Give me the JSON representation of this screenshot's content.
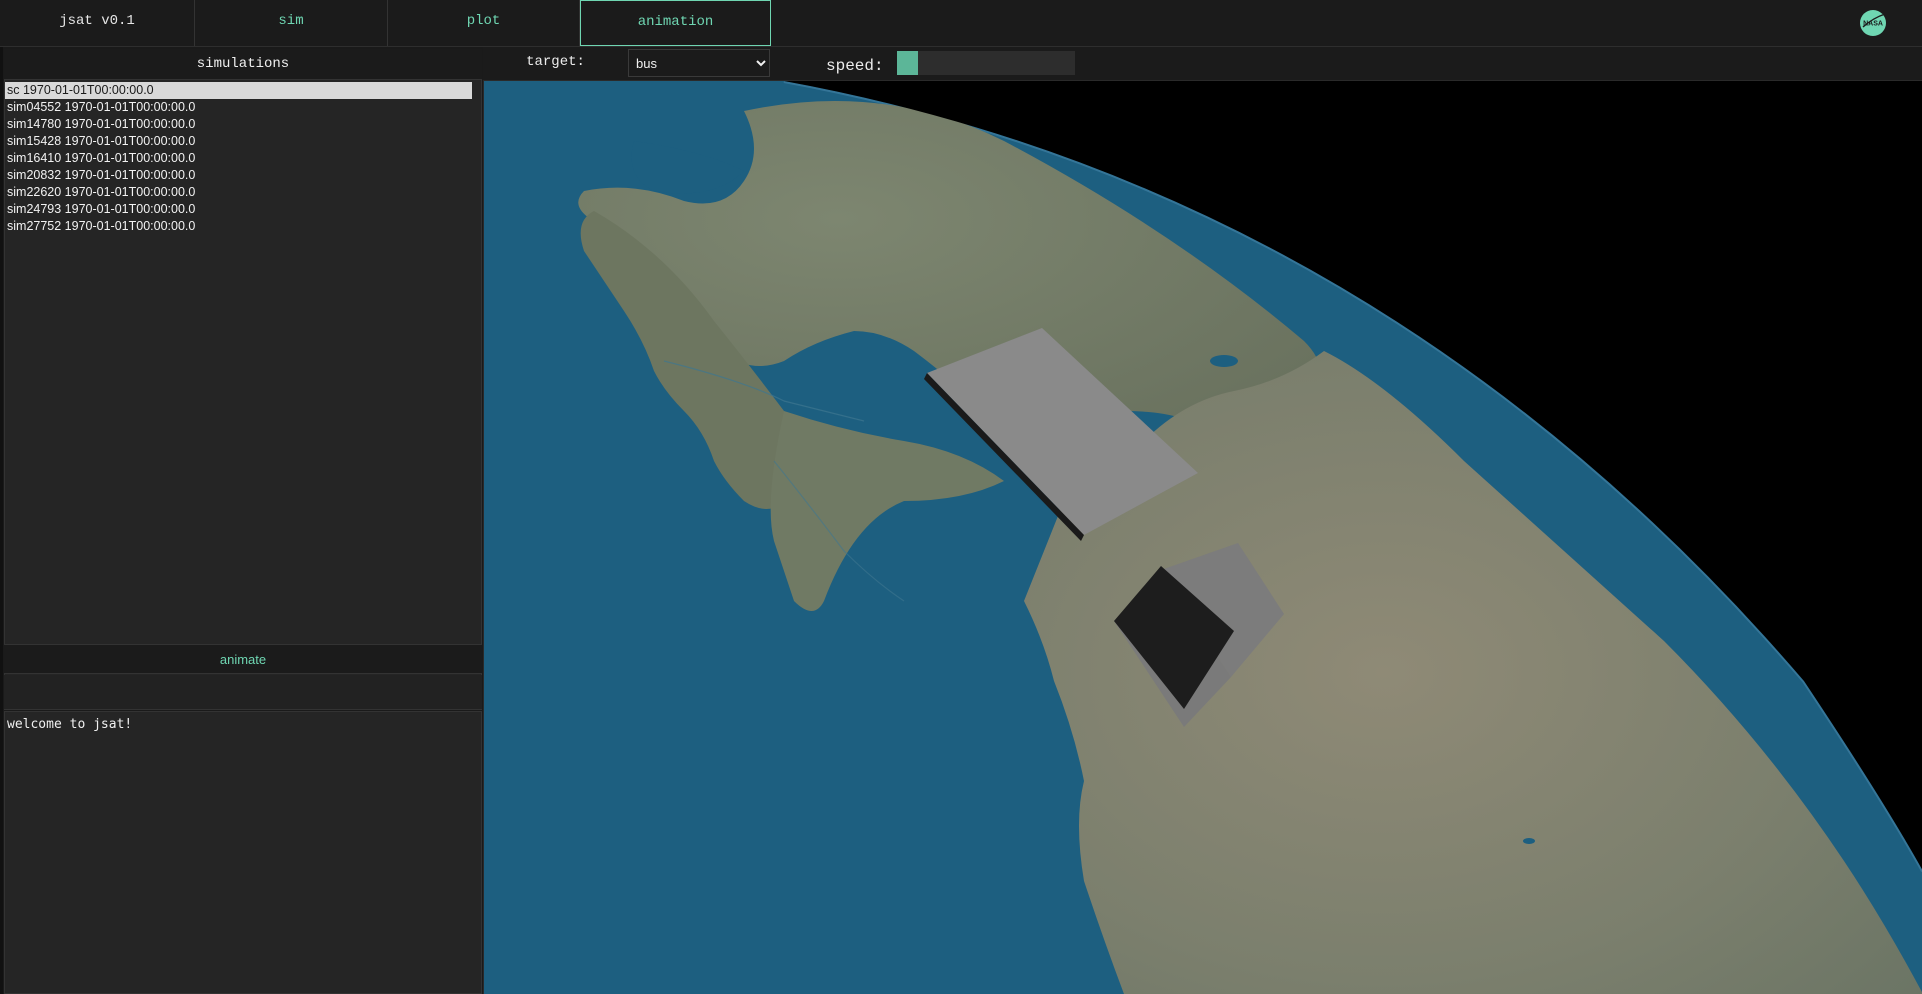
{
  "nav": {
    "app_title": "jsat v0.1",
    "tabs": [
      {
        "label": "sim"
      },
      {
        "label": "plot"
      },
      {
        "label": "animation",
        "active": true
      }
    ],
    "logo_text": "NASA"
  },
  "simulations": {
    "header": "simulations",
    "items": [
      {
        "label": "sc 1970-01-01T00:00:00.0",
        "selected": true
      },
      {
        "label": "sim04552 1970-01-01T00:00:00.0"
      },
      {
        "label": "sim14780 1970-01-01T00:00:00.0"
      },
      {
        "label": "sim15428 1970-01-01T00:00:00.0"
      },
      {
        "label": "sim16410 1970-01-01T00:00:00.0"
      },
      {
        "label": "sim20832 1970-01-01T00:00:00.0"
      },
      {
        "label": "sim22620 1970-01-01T00:00:00.0"
      },
      {
        "label": "sim24793 1970-01-01T00:00:00.0"
      },
      {
        "label": "sim27752 1970-01-01T00:00:00.0"
      }
    ],
    "animate_label": "animate"
  },
  "console": {
    "text": "welcome to jsat!"
  },
  "toolbar": {
    "target_label": "target:",
    "target_value": "bus",
    "speed_label": "speed:",
    "speed_fraction": 0.12
  },
  "colors": {
    "accent": "#6fd6b2",
    "speed_fill": "#5cb698",
    "ocean": "#1d5f80",
    "land": "#6f7a63",
    "panel_bg": "#1b1b1b"
  }
}
